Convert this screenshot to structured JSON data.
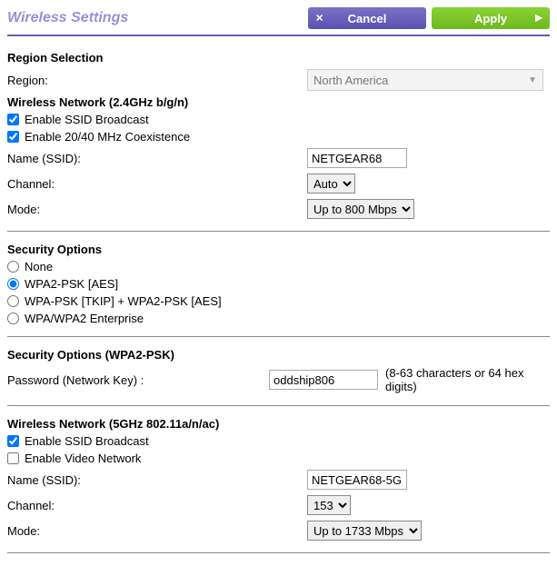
{
  "title": "Wireless Settings",
  "buttons": {
    "cancel": "Cancel",
    "apply": "Apply"
  },
  "region_section": {
    "heading": "Region Selection",
    "label": "Region:",
    "value": "North America"
  },
  "net24": {
    "heading": "Wireless Network (2.4GHz b/g/n)",
    "ssid_broadcast_label": "Enable SSID Broadcast",
    "coexistence_label": "Enable 20/40 MHz Coexistence",
    "name_label": "Name (SSID):",
    "name_value": "NETGEAR68",
    "channel_label": "Channel:",
    "channel_value": "Auto",
    "mode_label": "Mode:",
    "mode_value": "Up to 800 Mbps"
  },
  "security": {
    "heading": "Security Options",
    "options": {
      "none": "None",
      "wpa2aes": "WPA2-PSK [AES]",
      "tkip": "WPA-PSK [TKIP] + WPA2-PSK [AES]",
      "enterprise": "WPA/WPA2 Enterprise"
    }
  },
  "psk": {
    "heading": "Security Options (WPA2-PSK)",
    "label": "Password (Network Key) :",
    "value": "oddship806",
    "hint": "(8-63 characters or 64 hex digits)"
  },
  "net5": {
    "heading": "Wireless Network (5GHz 802.11a/n/ac)",
    "ssid_broadcast_label": "Enable SSID Broadcast",
    "video_label": "Enable Video Network",
    "name_label": "Name (SSID):",
    "name_value": "NETGEAR68-5G",
    "channel_label": "Channel:",
    "channel_value": "153",
    "mode_label": "Mode:",
    "mode_value": "Up to 1733 Mbps"
  }
}
